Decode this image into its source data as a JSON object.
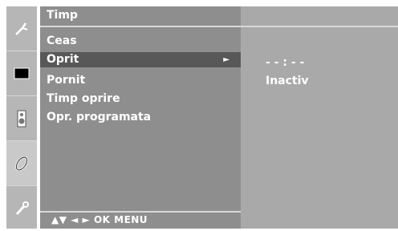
{
  "menu": {
    "title": "Timp",
    "items": [
      {
        "label": "Ceas",
        "selected": false
      },
      {
        "label": "Oprit",
        "selected": true,
        "arrow": "►"
      },
      {
        "label": "Pornit",
        "selected": false
      },
      {
        "label": "Timp oprire",
        "selected": false
      },
      {
        "label": "Opr. programata",
        "selected": false
      }
    ],
    "footer": "▲▼  ◄ ►  OK  MENU"
  },
  "values": {
    "time": "- - : - -",
    "status": "Inactiv"
  },
  "rail": {
    "icons": [
      "antenna-icon",
      "picture-icon",
      "speaker-icon",
      "time-icon",
      "option-icon"
    ],
    "active_index": 3
  },
  "colors": {
    "menu_bg": "#8e8e8e",
    "selected_bg": "#585858",
    "value_bg": "#a9a9a9",
    "rail_bg": "#b6b6b6"
  }
}
